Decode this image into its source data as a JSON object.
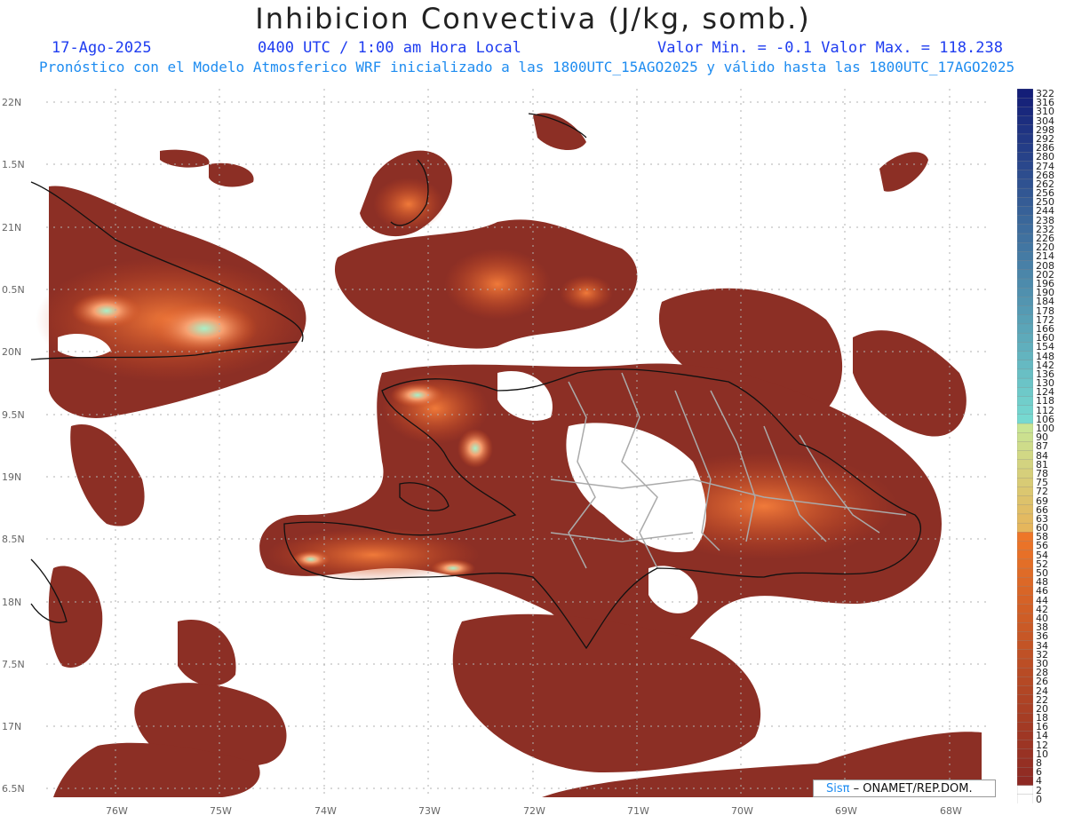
{
  "title": "Inhibicion Convectiva (J/kg, somb.)",
  "header": {
    "date": "17-Ago-2025",
    "time": "0400 UTC / 1:00 am Hora Local",
    "minmax": "Valor Min. = -0.1  Valor Max. = 118.238",
    "model_line": "Pronóstico con el Modelo Atmosferico WRF inicializado a las 1800UTC_15AGO2025 y válido hasta las  1800UTC_17AGO2025"
  },
  "lat_labels": [
    "22N",
    "1.5N",
    "21N",
    "0.5N",
    "20N",
    "9.5N",
    "19N",
    "8.5N",
    "18N",
    "7.5N",
    "17N",
    "6.5N"
  ],
  "lon_labels": [
    "76W",
    "75W",
    "74W",
    "73W",
    "72W",
    "71W",
    "70W",
    "69W",
    "68W"
  ],
  "colorbar": {
    "labels": [
      "322",
      "316",
      "310",
      "304",
      "298",
      "292",
      "286",
      "280",
      "274",
      "268",
      "262",
      "256",
      "250",
      "244",
      "238",
      "232",
      "226",
      "220",
      "214",
      "208",
      "202",
      "196",
      "190",
      "184",
      "178",
      "172",
      "166",
      "160",
      "154",
      "148",
      "142",
      "136",
      "130",
      "124",
      "118",
      "112",
      "106",
      "100",
      "90",
      "87",
      "84",
      "81",
      "78",
      "75",
      "72",
      "69",
      "66",
      "63",
      "60",
      "58",
      "56",
      "54",
      "52",
      "50",
      "48",
      "46",
      "44",
      "42",
      "40",
      "38",
      "36",
      "34",
      "32",
      "30",
      "28",
      "26",
      "24",
      "22",
      "20",
      "18",
      "16",
      "14",
      "12",
      "10",
      "8",
      "6",
      "4",
      "2",
      "0"
    ]
  },
  "credit": {
    "sis": "Sisπ",
    "rest": " – ONAMET/REP.DOM."
  },
  "colors": {
    "land": "#8c2f25",
    "high": "#e85a1a",
    "peak": "#9cecc0",
    "border_country": "#111111",
    "border_province": "#aaaaaa"
  }
}
